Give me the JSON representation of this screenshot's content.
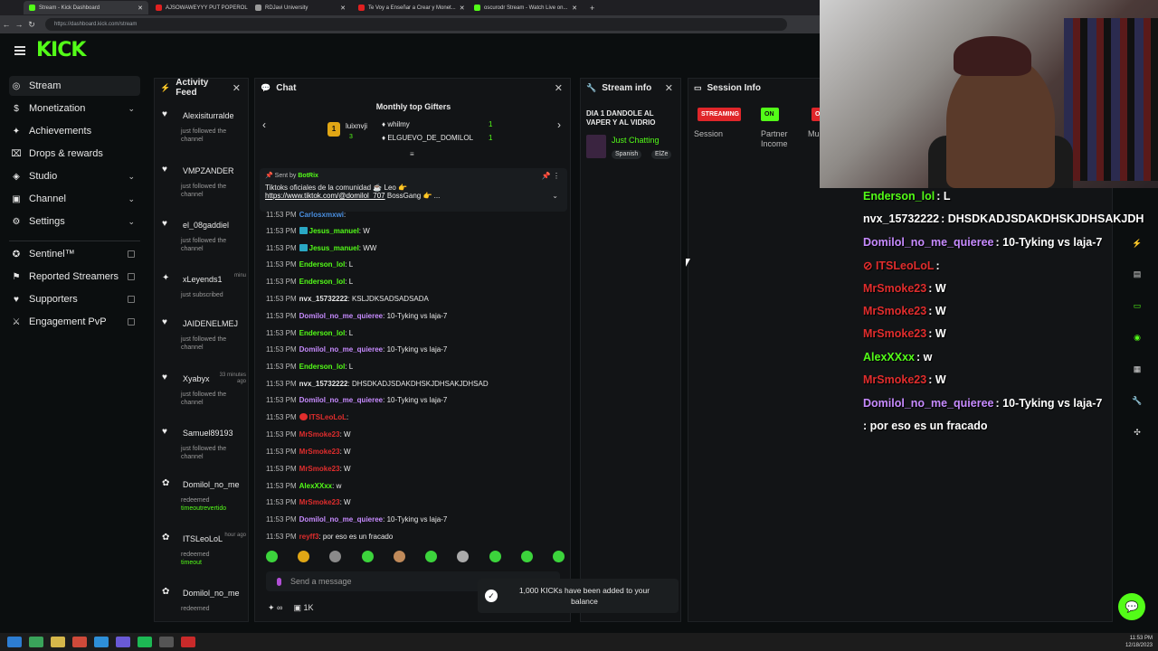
{
  "browser": {
    "tabs": [
      {
        "title": "Stream - Kick Dashboard",
        "color": "#53fc18",
        "active": true
      },
      {
        "title": "AJSOWAWEYYY PUT POPEROLIN...",
        "color": "#e02020",
        "active": false
      },
      {
        "title": "RDJavi University",
        "color": "#9a9a9a",
        "active": false
      },
      {
        "title": "Te Voy a Enseñar a Crear y Monet...",
        "color": "#e02020",
        "active": false
      },
      {
        "title": "oscurodr Stream - Watch Live on...",
        "color": "#53fc18",
        "active": false
      }
    ],
    "new_tab_label": "+",
    "url": "https://dashboard.kick.com/stream"
  },
  "header": {
    "logo": "KICK"
  },
  "sidebar": {
    "items": [
      {
        "label": "Stream",
        "icon": "stream-icon"
      },
      {
        "label": "Monetization",
        "icon": "dollar-icon"
      },
      {
        "label": "Achievements",
        "icon": "trophy-icon"
      },
      {
        "label": "Drops & rewards",
        "icon": "gift-icon"
      },
      {
        "label": "Studio",
        "icon": "video-icon"
      },
      {
        "label": "Channel",
        "icon": "channel-icon"
      },
      {
        "label": "Settings",
        "icon": "gear-icon"
      },
      {
        "label": "Sentinel™",
        "icon": "shield-icon"
      },
      {
        "label": "Reported Streamers",
        "icon": "flag-icon"
      },
      {
        "label": "Supporters",
        "icon": "heart-icon"
      },
      {
        "label": "Engagement PvP",
        "icon": "swords-icon"
      }
    ]
  },
  "activity": {
    "title": "Activity Feed",
    "entries": [
      {
        "name": "Alexisiturralde",
        "time": "",
        "desc": "just followed the channel",
        "extra": ""
      },
      {
        "name": "VMPZANDER",
        "time": "",
        "desc": "just followed the channel",
        "extra": ""
      },
      {
        "name": "el_08gaddiel",
        "time": "",
        "desc": "just followed the channel",
        "extra": ""
      },
      {
        "name": "xLeyends1",
        "time": "minu",
        "desc": "just subscribed",
        "extra": ""
      },
      {
        "name": "JAIDENELMEJ",
        "time": "",
        "desc": "just followed the channel",
        "extra": ""
      },
      {
        "name": "Xyabyx",
        "time": "33 minutes ago",
        "desc": "just followed the channel",
        "extra": ""
      },
      {
        "name": "Samuel89193",
        "time": "",
        "desc": "just followed the channel",
        "extra": ""
      },
      {
        "name": "Domilol_no_me",
        "time": "",
        "desc": "redeemed",
        "extra": "timeoutrevertido"
      },
      {
        "name": "ITSLeoLoL",
        "time": "hour ago",
        "desc": "redeemed",
        "extra": "timeout"
      },
      {
        "name": "Domilol_no_me",
        "time": "",
        "desc": "redeemed",
        "extra": ""
      }
    ]
  },
  "chat": {
    "title": "Chat",
    "gifters_title": "Monthly top Gifters",
    "gifters": [
      {
        "name": "luixnvji",
        "count": "3"
      },
      {
        "name": "whilmy",
        "count": "1"
      },
      {
        "name": "ELGUEVO_DE_DOMILOL",
        "count": "1"
      }
    ],
    "pinned": {
      "sent_by": "Sent by",
      "sender": "BotRix",
      "text": "Tiktoks oficiales de la comunidad ☕ Leo 👉",
      "link": "https://www.tiktok.com/@domilol_707",
      "tail": "BossGang 👉 ..."
    },
    "messages": [
      {
        "time": "11:53 PM",
        "user": "Jesus_manuel",
        "color": "#53fc18",
        "text": "W"
      },
      {
        "time": "11:53 PM",
        "user": "Carlosxmxwi",
        "color": "#4a90e2",
        "text": ""
      },
      {
        "time": "11:53 PM",
        "user": "Jesus_manuel",
        "color": "#53fc18",
        "text": "W"
      },
      {
        "time": "11:53 PM",
        "user": "Jesus_manuel",
        "color": "#53fc18",
        "text": "WW"
      },
      {
        "time": "11:53 PM",
        "user": "Enderson_lol",
        "color": "#53fc18",
        "text": "L"
      },
      {
        "time": "11:53 PM",
        "user": "Enderson_lol",
        "color": "#53fc18",
        "text": "L"
      },
      {
        "time": "11:53 PM",
        "user": "nvx_15732222",
        "color": "#e8e8e8",
        "text": "KSLJDKSADSADSADA"
      },
      {
        "time": "11:53 PM",
        "user": "Domilol_no_me_quieree",
        "color": "#c78bff",
        "text": "10-Tyking vs laja-7"
      },
      {
        "time": "11:53 PM",
        "user": "Enderson_lol",
        "color": "#53fc18",
        "text": "L"
      },
      {
        "time": "11:53 PM",
        "user": "Domilol_no_me_quieree",
        "color": "#c78bff",
        "text": "10-Tyking vs laja-7"
      },
      {
        "time": "11:53 PM",
        "user": "Enderson_lol",
        "color": "#53fc18",
        "text": "L"
      },
      {
        "time": "11:53 PM",
        "user": "nvx_15732222",
        "color": "#e8e8e8",
        "text": "DHSDKADJSDAKDHSKJDHSAKJDHSAD"
      },
      {
        "time": "11:53 PM",
        "user": "Domilol_no_me_quieree",
        "color": "#c78bff",
        "text": "10-Tyking vs laja-7"
      },
      {
        "time": "11:53 PM",
        "user": "ITSLeoLoL",
        "color": "#e02d2d",
        "text": ""
      },
      {
        "time": "11:53 PM",
        "user": "MrSmoke23",
        "color": "#e02d2d",
        "text": "W"
      },
      {
        "time": "11:53 PM",
        "user": "MrSmoke23",
        "color": "#e02d2d",
        "text": "W"
      },
      {
        "time": "11:53 PM",
        "user": "MrSmoke23",
        "color": "#e02d2d",
        "text": "W"
      },
      {
        "time": "11:53 PM",
        "user": "AlexXXxx",
        "color": "#53fc18",
        "text": "w"
      },
      {
        "time": "11:53 PM",
        "user": "MrSmoke23",
        "color": "#e02d2d",
        "text": "W"
      },
      {
        "time": "11:53 PM",
        "user": "Domilol_no_me_quieree",
        "color": "#c78bff",
        "text": "10-Tyking vs laja-7"
      },
      {
        "time": "11:53 PM",
        "user": "reyff3",
        "color": "#e02d2d",
        "text": "por eso es un fracado"
      }
    ],
    "input_placeholder": "Send a message",
    "viewers": "1K"
  },
  "stream_info": {
    "title": "Stream info",
    "stream_title": "DIA 1 DANDOLE AL VAPER Y AL VIDRIO",
    "category": "Just Chatting",
    "tags": [
      "Spanish",
      "ElZe"
    ]
  },
  "session_info": {
    "title": "Session Info",
    "badges": [
      {
        "label": "STREAMING",
        "color": "#e0262a",
        "text_color": "#ffffff"
      },
      {
        "label": "ON",
        "color": "#53fc18",
        "text_color": "#111111"
      },
      {
        "label": "OF",
        "color": "#e0262a",
        "text_color": "#ffffff"
      }
    ],
    "labels": [
      "Session",
      "Partner Income",
      "Mu"
    ]
  },
  "overlay_chat": [
    {
      "user": "Enderson_lol",
      "color": "#53fc18",
      "text": ": L"
    },
    {
      "user": "nvx_15732222",
      "color": "#ffffff",
      "text": ": DHSDKADJSDAKDHSKJDHSAKJDH"
    },
    {
      "user": "Domilol_no_me_quieree",
      "color": "#c78bff",
      "text": ": 10-Tyking vs laja-7"
    },
    {
      "user": "ITSLeoLoL",
      "color": "#e02d2d",
      "text": ":"
    },
    {
      "user": "MrSmoke23",
      "color": "#e02d2d",
      "text": ": W"
    },
    {
      "user": "MrSmoke23",
      "color": "#e02d2d",
      "text": ": W"
    },
    {
      "user": "MrSmoke23",
      "color": "#e02d2d",
      "text": ": W"
    },
    {
      "user": "AlexXXxx",
      "color": "#53fc18",
      "text": ": w"
    },
    {
      "user": "MrSmoke23",
      "color": "#e02d2d",
      "text": ": W"
    },
    {
      "user": "Domilol_no_me_quieree",
      "color": "#c78bff",
      "text": ": 10-Tyking vs laja-7"
    },
    {
      "user": "",
      "color": "#ffffff",
      "text": ": por eso es un fracado"
    }
  ],
  "toast": {
    "text": "1,000 KICKs have been added to your balance"
  },
  "taskbar": {
    "time": "11:53 PM",
    "date": "12/18/2023"
  },
  "colors": {
    "accent": "#53fc18",
    "background": "#0b0e0f",
    "panel": "#121416"
  }
}
